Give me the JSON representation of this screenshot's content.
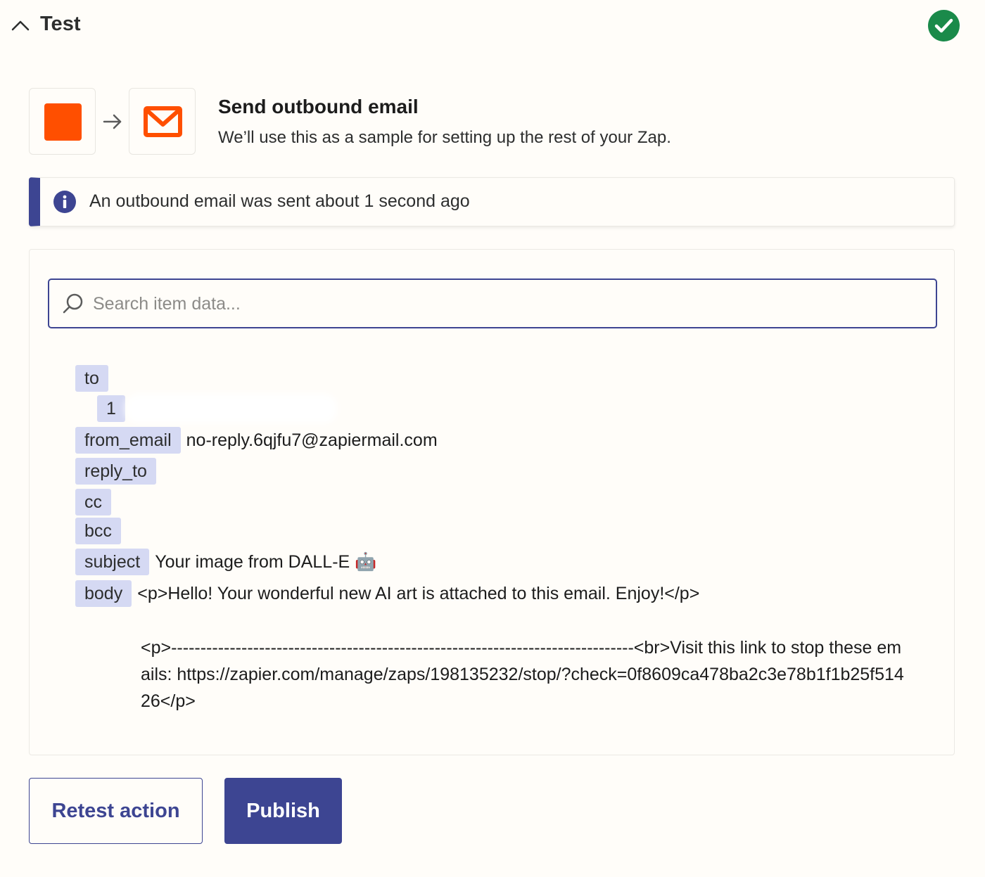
{
  "header": {
    "title": "Test",
    "status": "success"
  },
  "step": {
    "title": "Send outbound email",
    "description": "We’ll use this as a sample for setting up the rest of your Zap."
  },
  "banner": {
    "text": "An outbound email was sent about 1 second ago"
  },
  "search": {
    "placeholder": "Search item data..."
  },
  "fields": {
    "to": {
      "key": "to",
      "sub_key": "1"
    },
    "from_email": {
      "key": "from_email",
      "value": "no-reply.6qjfu7@zapiermail.com"
    },
    "reply_to": {
      "key": "reply_to"
    },
    "cc": {
      "key": "cc"
    },
    "bcc": {
      "key": "bcc"
    },
    "subject": {
      "key": "subject",
      "value": "Your image from DALL-E 🤖"
    },
    "body": {
      "key": "body",
      "value": "<p>Hello! Your wonderful new AI art is attached to this email. Enjoy!</p>",
      "continuation": "<p>-------------------------------------------------------------------------------<br>Visit this link to stop these emails: https://zapier.com/manage/zaps/198135232/stop/?check=0f8609ca478ba2c3e78b1f1b25f51426</p>"
    }
  },
  "buttons": {
    "retest": "Retest action",
    "publish": "Publish"
  },
  "colors": {
    "accent": "#3d4592",
    "brand_orange": "#ff4f00",
    "success": "#1a8a4a",
    "key_bg": "#d5d9f3",
    "background": "#fffdf9"
  },
  "icons": {
    "trigger": "orange-square-icon",
    "action": "email-icon",
    "banner": "info-icon",
    "status": "check-circle-icon"
  }
}
